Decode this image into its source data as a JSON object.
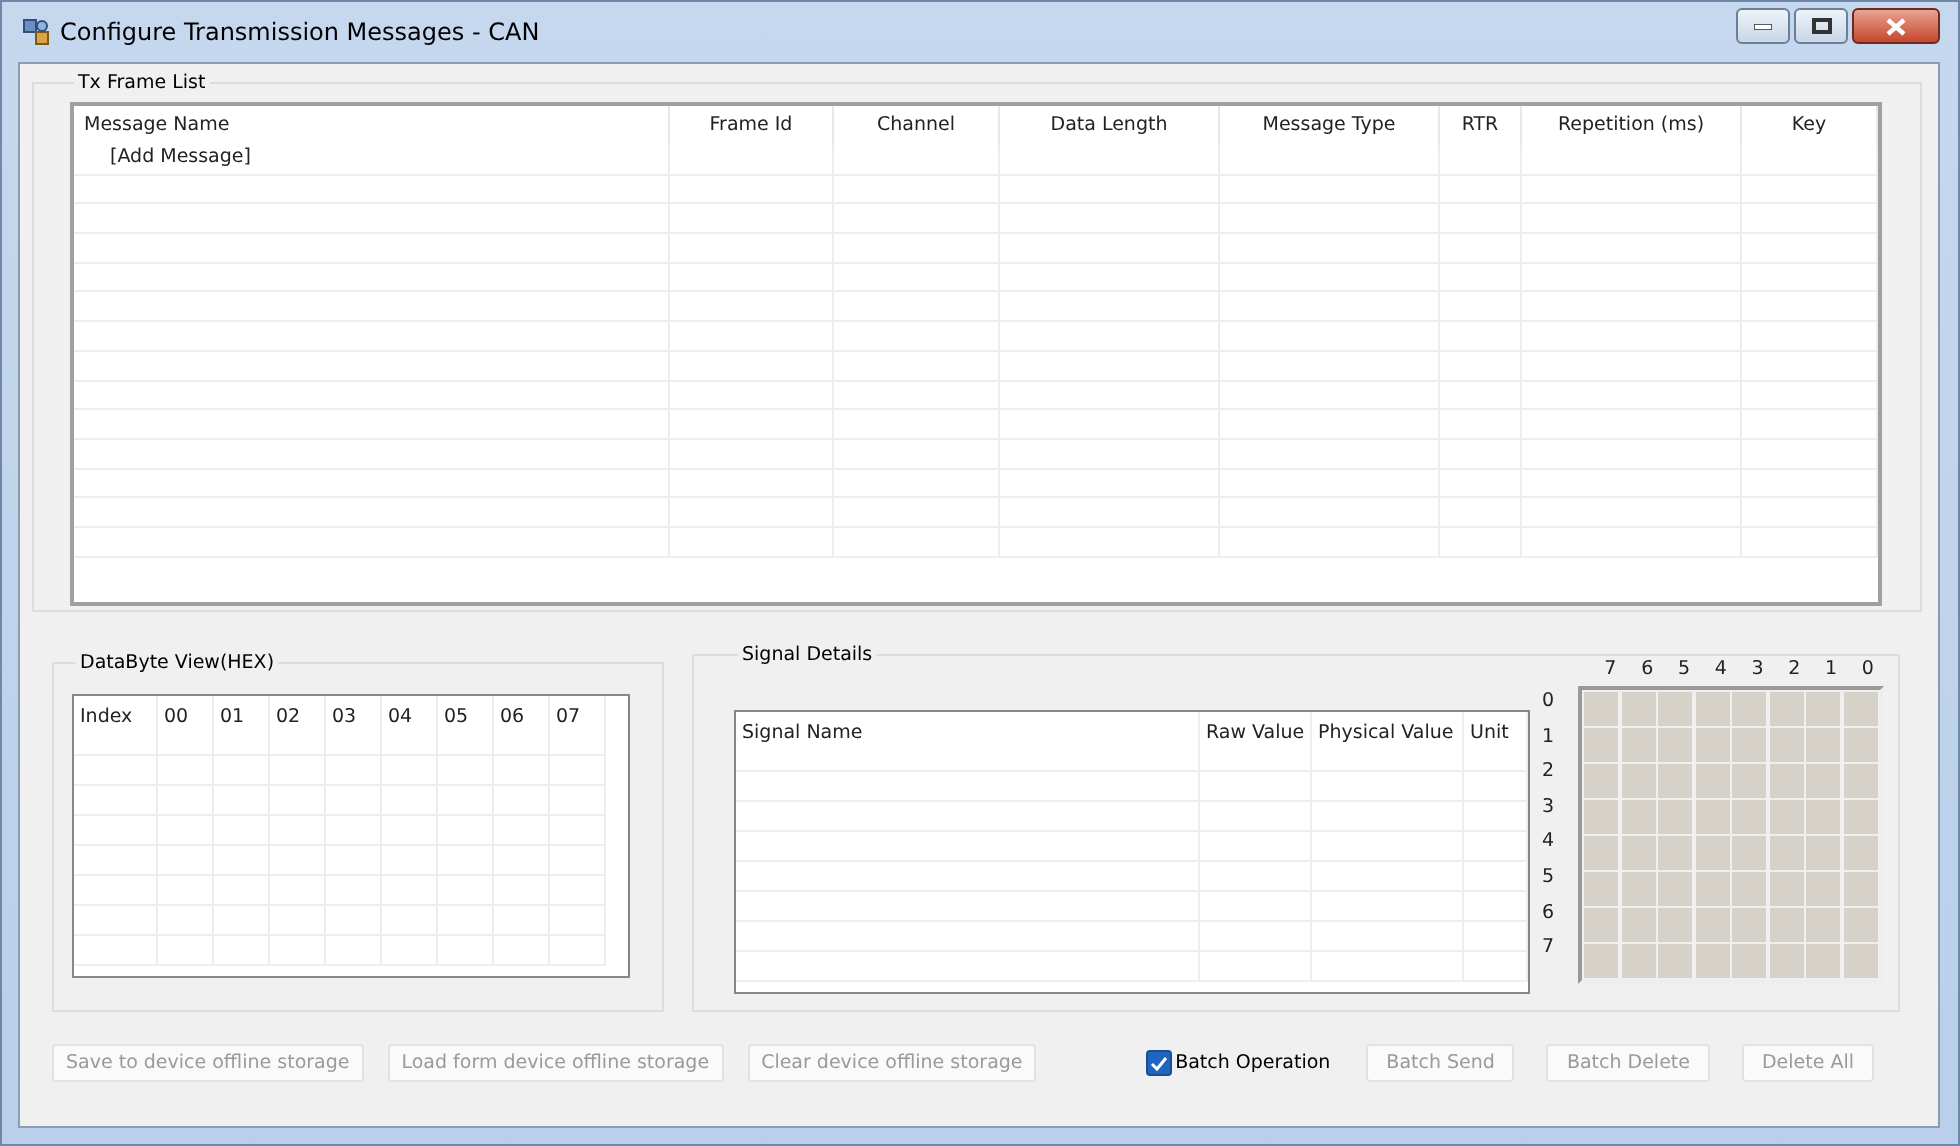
{
  "window": {
    "title": "Configure Transmission Messages - CAN"
  },
  "tx_frame_list": {
    "title": "Tx Frame List",
    "columns": [
      "Message Name",
      "Frame Id",
      "Channel",
      "Data Length",
      "Message Type",
      "RTR",
      "Repetition (ms)",
      "Key"
    ],
    "rows": [
      {
        "message_name": "[Add Message]"
      }
    ]
  },
  "databyte_view": {
    "title": "DataByte View(HEX)",
    "columns": [
      "Index",
      "00",
      "01",
      "02",
      "03",
      "04",
      "05",
      "06",
      "07"
    ]
  },
  "signal_details": {
    "title": "Signal Details",
    "columns": [
      "Signal Name",
      "Raw Value",
      "Physical Value",
      "Unit"
    ]
  },
  "bit_grid": {
    "column_labels": [
      "7",
      "6",
      "5",
      "4",
      "3",
      "2",
      "1",
      "0"
    ],
    "row_labels": [
      "0",
      "1",
      "2",
      "3",
      "4",
      "5",
      "6",
      "7"
    ]
  },
  "storage_buttons": [
    {
      "label": "Save to device offline storage",
      "disabled": true
    },
    {
      "label": "Load form device offline storage",
      "disabled": true
    },
    {
      "label": "Clear device offline storage",
      "disabled": true
    }
  ],
  "batch_operation": {
    "label": "Batch Operation",
    "checked": true
  },
  "batch_buttons": [
    {
      "label": "Batch Send",
      "disabled": true
    },
    {
      "label": "Batch Delete",
      "disabled": true
    },
    {
      "label": "Delete All",
      "disabled": true
    }
  ]
}
